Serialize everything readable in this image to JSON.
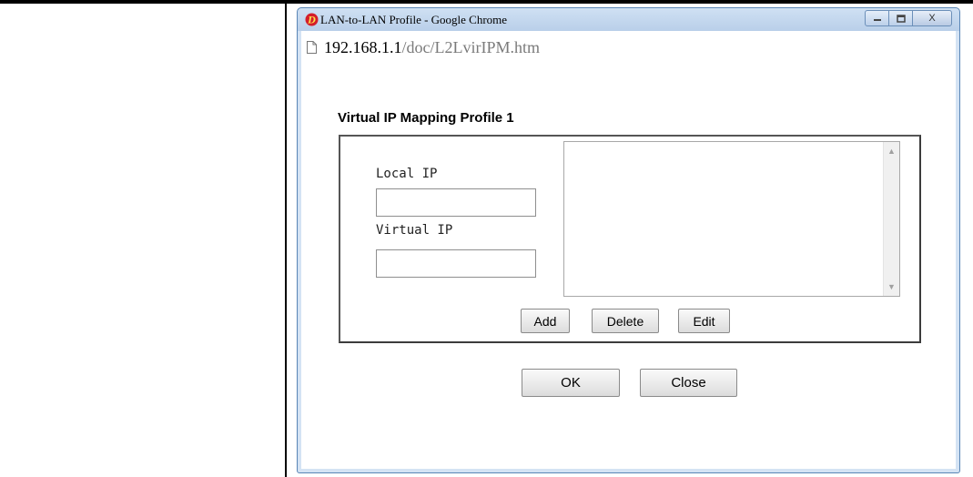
{
  "window": {
    "title": "LAN-to-LAN Profile - Google Chrome",
    "controls": {
      "minimize": "—",
      "maximize": "□",
      "close": "X"
    }
  },
  "address": {
    "host": "192.168.1.1",
    "path": "/doc/L2LvirIPM.htm"
  },
  "profile": {
    "title": "Virtual IP Mapping Profile 1",
    "local_ip_label": "Local IP",
    "local_ip_value": "",
    "virtual_ip_label": "Virtual IP",
    "virtual_ip_value": "",
    "list_items": []
  },
  "buttons": {
    "add": "Add",
    "delete": "Delete",
    "edit": "Edit",
    "ok": "OK",
    "close": "Close"
  },
  "icons": {
    "app": "draytek-logo-icon",
    "page": "page-icon"
  },
  "colors": {
    "window_frame": "#5a86b6",
    "title_bar": "#cfe0f3",
    "app_icon": "#d41e2a"
  }
}
